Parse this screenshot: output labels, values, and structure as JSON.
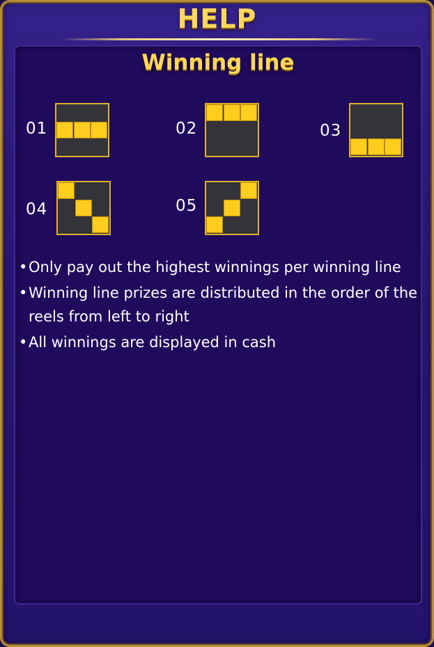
{
  "header": {
    "title": "HELP"
  },
  "section": {
    "title": "Winning line"
  },
  "lines": [
    {
      "label": "01",
      "cells": [
        [
          0,
          1
        ],
        [
          1,
          1
        ],
        [
          2,
          1
        ]
      ]
    },
    {
      "label": "02",
      "cells": [
        [
          0,
          0
        ],
        [
          1,
          0
        ],
        [
          2,
          0
        ]
      ]
    },
    {
      "label": "03",
      "cells": [
        [
          0,
          2
        ],
        [
          1,
          2
        ],
        [
          2,
          2
        ]
      ]
    },
    {
      "label": "04",
      "cells": [
        [
          0,
          0
        ],
        [
          1,
          1
        ],
        [
          2,
          2
        ]
      ]
    },
    {
      "label": "05",
      "cells": [
        [
          0,
          2
        ],
        [
          1,
          1
        ],
        [
          2,
          0
        ]
      ]
    }
  ],
  "rules": [
    "Only pay out the highest winnings per winning line",
    "Winning line prizes are distributed in the order of the reels from left to right",
    "All winnings are displayed in cash"
  ],
  "bullet": "•",
  "colors": {
    "title_gold": "#ffd75a",
    "cell_yellow": "#ffcd1e",
    "panel": "#1f0a5c",
    "frame_border": "#b78f3c"
  }
}
